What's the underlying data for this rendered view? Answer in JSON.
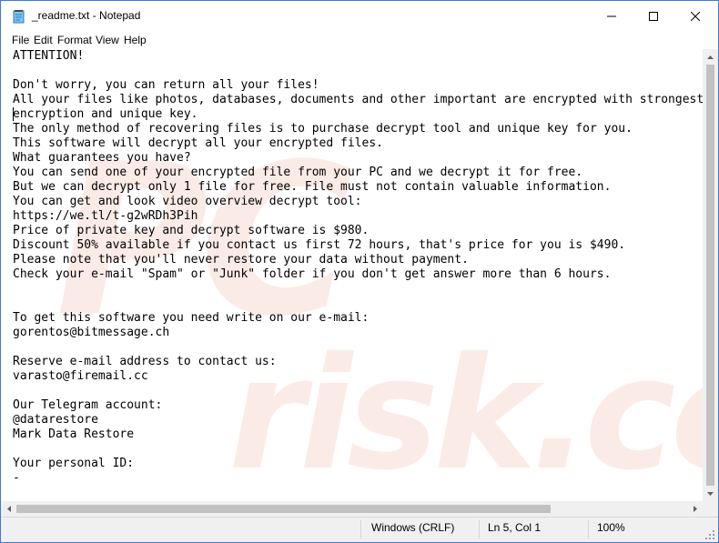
{
  "window": {
    "title": "_readme.txt - Notepad",
    "file_icon": "notepad-icon",
    "controls": {
      "minimize": "minimize-icon",
      "maximize": "maximize-icon",
      "close": "close-icon"
    }
  },
  "menu": {
    "items": [
      "File",
      "Edit",
      "Format",
      "View",
      "Help"
    ]
  },
  "document": {
    "lines": [
      "ATTENTION!",
      "",
      "Don't worry, you can return all your files!",
      "All your files like photos, databases, documents and other important are encrypted with strongest",
      "encryption and unique key.",
      "The only method of recovering files is to purchase decrypt tool and unique key for you.",
      "This software will decrypt all your encrypted files.",
      "What guarantees you have?",
      "You can send one of your encrypted file from your PC and we decrypt it for free.",
      "But we can decrypt only 1 file for free. File must not contain valuable information.",
      "You can get and look video overview decrypt tool:",
      "https://we.tl/t-g2wRDh3Pih",
      "Price of private key and decrypt software is $980.",
      "Discount 50% available if you contact us first 72 hours, that's price for you is $490.",
      "Please note that you'll never restore your data without payment.",
      "Check your e-mail \"Spam\" or \"Junk\" folder if you don't get answer more than 6 hours.",
      "",
      "",
      "To get this software you need write on our e-mail:",
      "gorentos@bitmessage.ch",
      "",
      "Reserve e-mail address to contact us:",
      "varasto@firemail.cc",
      "",
      "Our Telegram account:",
      "@datarestore",
      "Mark Data Restore",
      "",
      "Your personal ID:",
      "-"
    ],
    "watermark": "PC risk.com"
  },
  "status": {
    "line_ending": "Windows (CRLF)",
    "position": "Ln 5, Col 1",
    "zoom": "100%"
  },
  "colors": {
    "window_border": "#3a7bd5",
    "statusbar_bg": "#f0f0f0",
    "scrollbar_thumb": "#c1c1c1",
    "watermark": "#fbe9e4"
  }
}
